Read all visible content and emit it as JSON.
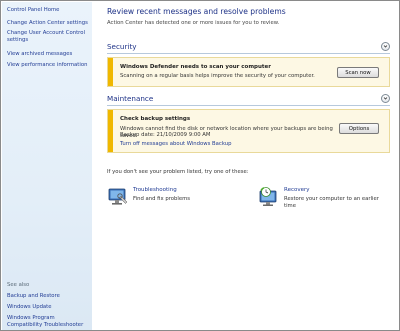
{
  "sidebar": {
    "home": "Control Panel Home",
    "links": [
      "Change Action Center settings",
      "Change User Account Control settings",
      "View archived messages",
      "View performance information"
    ],
    "see_also_heading": "See also",
    "see_also": [
      "Backup and Restore",
      "Windows Update",
      "Windows Program Compatibility Troubleshooter"
    ]
  },
  "main": {
    "title": "Review recent messages and resolve problems",
    "subtitle": "Action Center has detected one or more issues for you to review.",
    "security": {
      "heading": "Security",
      "card_title": "Windows Defender needs to scan your computer",
      "card_text": "Scanning on a regular basis helps improve the security of your computer.",
      "button": "Scan now"
    },
    "maintenance": {
      "heading": "Maintenance",
      "card_title": "Check backup settings",
      "card_text": "Windows cannot find the disk or network location where your backups are being saved.",
      "card_date": "Backup date: 21/10/2009 9:00 AM",
      "card_link": "Turn off messages about Windows Backup",
      "button": "Options"
    },
    "hint": "If you don't see your problem listed, try one of these:",
    "tools": [
      {
        "link": "Troubleshooting",
        "desc": "Find and fix problems",
        "icon": "troubleshooting-icon"
      },
      {
        "link": "Recovery",
        "desc": "Restore your computer to an earlier time",
        "icon": "recovery-icon"
      }
    ]
  },
  "colors": {
    "accent_link": "#1f3a93",
    "heading": "#1e3287",
    "warning_bar": "#f0b800",
    "card_bg": "#fdf8e4"
  }
}
